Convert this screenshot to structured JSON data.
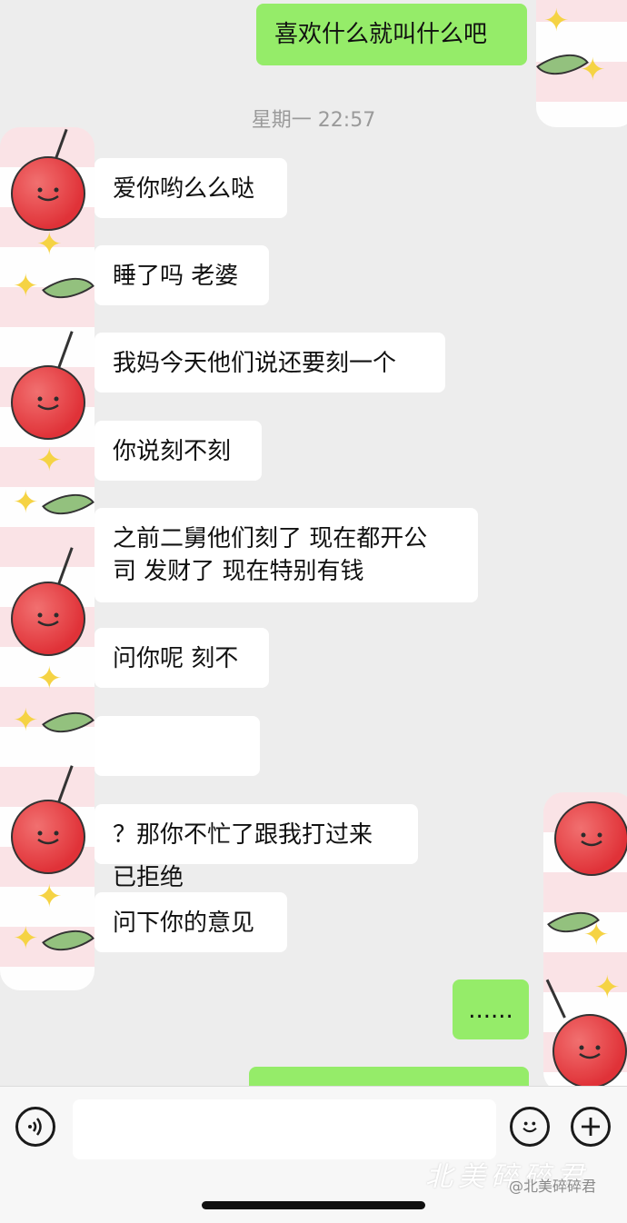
{
  "messages": {
    "out_top": "喜欢什么就叫什么吧",
    "time_divider": "星期一 22:57",
    "in_1": "爱你哟么么哒",
    "in_2": "睡了吗 老婆",
    "in_3": "我妈今天他们说还要刻一个",
    "in_4": "你说刻不刻",
    "in_5": "之前二舅他们刻了 现在都开公\n司 发财了 现在特别有钱",
    "in_6": "问你呢 刻不",
    "in_7_call": "已拒绝",
    "in_8": "？那你不忙了跟我打过来",
    "in_9": "问下你的意见",
    "out_bottom": "......"
  },
  "input_bar": {
    "placeholder": ""
  },
  "watermark": {
    "art_text": "北美碎碎君",
    "handle": "@北美碎碎君"
  },
  "colors": {
    "chat_bg": "#ededed",
    "outgoing_bubble": "#95ec69",
    "incoming_bubble": "#ffffff"
  },
  "icons": {
    "voice": "voice-icon",
    "emoji": "emoji-icon",
    "plus": "plus-icon",
    "hangup": "phone-hangup-icon"
  }
}
